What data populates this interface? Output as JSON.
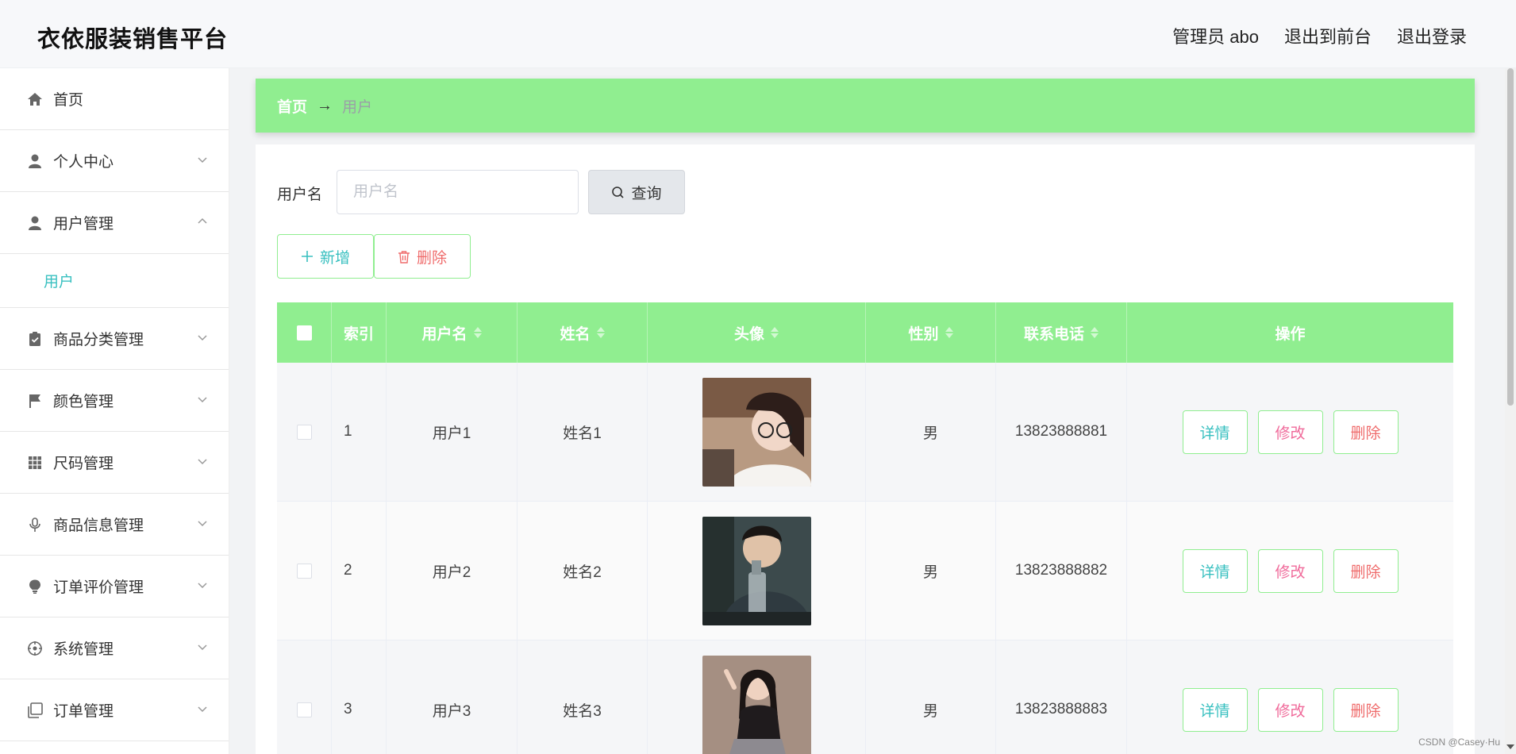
{
  "header": {
    "brand": "衣依服装销售平台",
    "links": [
      "管理员 abo",
      "退出到前台",
      "退出登录"
    ]
  },
  "sidebar": {
    "items": [
      {
        "label": "首页",
        "icon": "home-icon",
        "expandable": false
      },
      {
        "label": "个人中心",
        "icon": "person-icon",
        "expandable": true
      },
      {
        "label": "用户管理",
        "icon": "user-icon",
        "expandable": true,
        "expanded": true,
        "children": [
          "用户"
        ]
      },
      {
        "label": "商品分类管理",
        "icon": "clipboard-check-icon",
        "expandable": true
      },
      {
        "label": "颜色管理",
        "icon": "flag-icon",
        "expandable": true
      },
      {
        "label": "尺码管理",
        "icon": "grid-icon",
        "expandable": true
      },
      {
        "label": "商品信息管理",
        "icon": "microphone-icon",
        "expandable": true
      },
      {
        "label": "订单评价管理",
        "icon": "bulb-icon",
        "expandable": true
      },
      {
        "label": "系统管理",
        "icon": "crosshair-icon",
        "expandable": true
      },
      {
        "label": "订单管理",
        "icon": "copy-icon",
        "expandable": true
      }
    ]
  },
  "breadcrumb": {
    "home": "首页",
    "separator": "→",
    "current": "用户"
  },
  "search": {
    "label": "用户名",
    "placeholder": "用户名",
    "value": "",
    "button": "查询"
  },
  "actions": {
    "add": "新增",
    "delete": "删除"
  },
  "table": {
    "columns": [
      "",
      "索引",
      "用户名",
      "姓名",
      "头像",
      "性别",
      "联系电话",
      "操作"
    ],
    "rows": [
      {
        "index": "1",
        "username": "用户1",
        "name": "姓名1",
        "gender": "男",
        "phone": "13823888881"
      },
      {
        "index": "2",
        "username": "用户2",
        "name": "姓名2",
        "gender": "男",
        "phone": "13823888882"
      },
      {
        "index": "3",
        "username": "用户3",
        "name": "姓名3",
        "gender": "男",
        "phone": "13823888883"
      }
    ],
    "row_actions": [
      "详情",
      "修改",
      "删除"
    ]
  },
  "colors": {
    "accent_green": "#90ee90",
    "teal": "#39c0c0",
    "pink": "#f06a9a",
    "red": "#ef6b6b"
  },
  "watermark": "CSDN @Casey·Hu"
}
